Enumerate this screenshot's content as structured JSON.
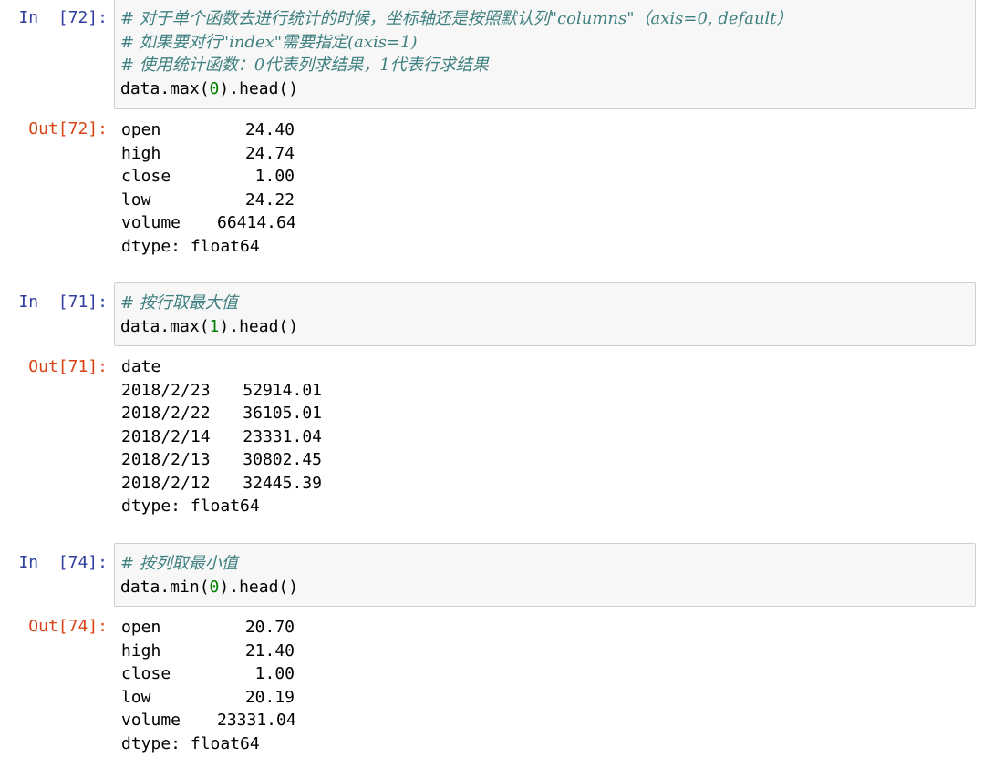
{
  "cells": [
    {
      "in_prompt": "In  [72]:",
      "code": {
        "comment1": "# 对于单个函数去进行统计的时候，坐标轴还是按照默认列\"columns\"（axis=0, default）",
        "comment2": "# 如果要对行\"index\"需要指定(axis=1)",
        "comment3": "# 使用统计函数：0代表列求结果，1代表行求结果",
        "call_prefix": "data.max(",
        "call_arg": "0",
        "call_suffix": ").head()"
      },
      "out_prompt": "Out[72]:",
      "output": {
        "rows": [
          {
            "key": "open",
            "value": "24.40"
          },
          {
            "key": "high",
            "value": "24.74"
          },
          {
            "key": "close",
            "value": "1.00"
          },
          {
            "key": "low",
            "value": "24.22"
          },
          {
            "key": "volume",
            "value": "66414.64"
          }
        ],
        "dtype": "dtype: float64"
      }
    },
    {
      "in_prompt": "In  [71]:",
      "code": {
        "comment1": "# 按行取最大值",
        "call_prefix": "data.max(",
        "call_arg": "1",
        "call_suffix": ").head()"
      },
      "out_prompt": "Out[71]:",
      "output": {
        "index_name": "date",
        "rows": [
          {
            "key": "2018/2/23",
            "value": "52914.01"
          },
          {
            "key": "2018/2/22",
            "value": "36105.01"
          },
          {
            "key": "2018/2/14",
            "value": "23331.04"
          },
          {
            "key": "2018/2/13",
            "value": "30802.45"
          },
          {
            "key": "2018/2/12",
            "value": "32445.39"
          }
        ],
        "dtype": "dtype: float64"
      }
    },
    {
      "in_prompt": "In  [74]:",
      "code": {
        "comment1": "# 按列取最小值",
        "call_prefix": "data.min(",
        "call_arg": "0",
        "call_suffix": ").head()"
      },
      "out_prompt": "Out[74]:",
      "output": {
        "rows": [
          {
            "key": "open",
            "value": "20.70"
          },
          {
            "key": "high",
            "value": "21.40"
          },
          {
            "key": "close",
            "value": "1.00"
          },
          {
            "key": "low",
            "value": "20.19"
          },
          {
            "key": "volume",
            "value": "23331.04"
          }
        ],
        "dtype": "dtype: float64"
      }
    }
  ],
  "colors": {
    "in_prompt": "#303f9f",
    "out_prompt": "#d84315",
    "comment": "#408080",
    "number": "#008000",
    "cell_background": "#f7f7f7",
    "cell_border": "#cfcfcf"
  }
}
